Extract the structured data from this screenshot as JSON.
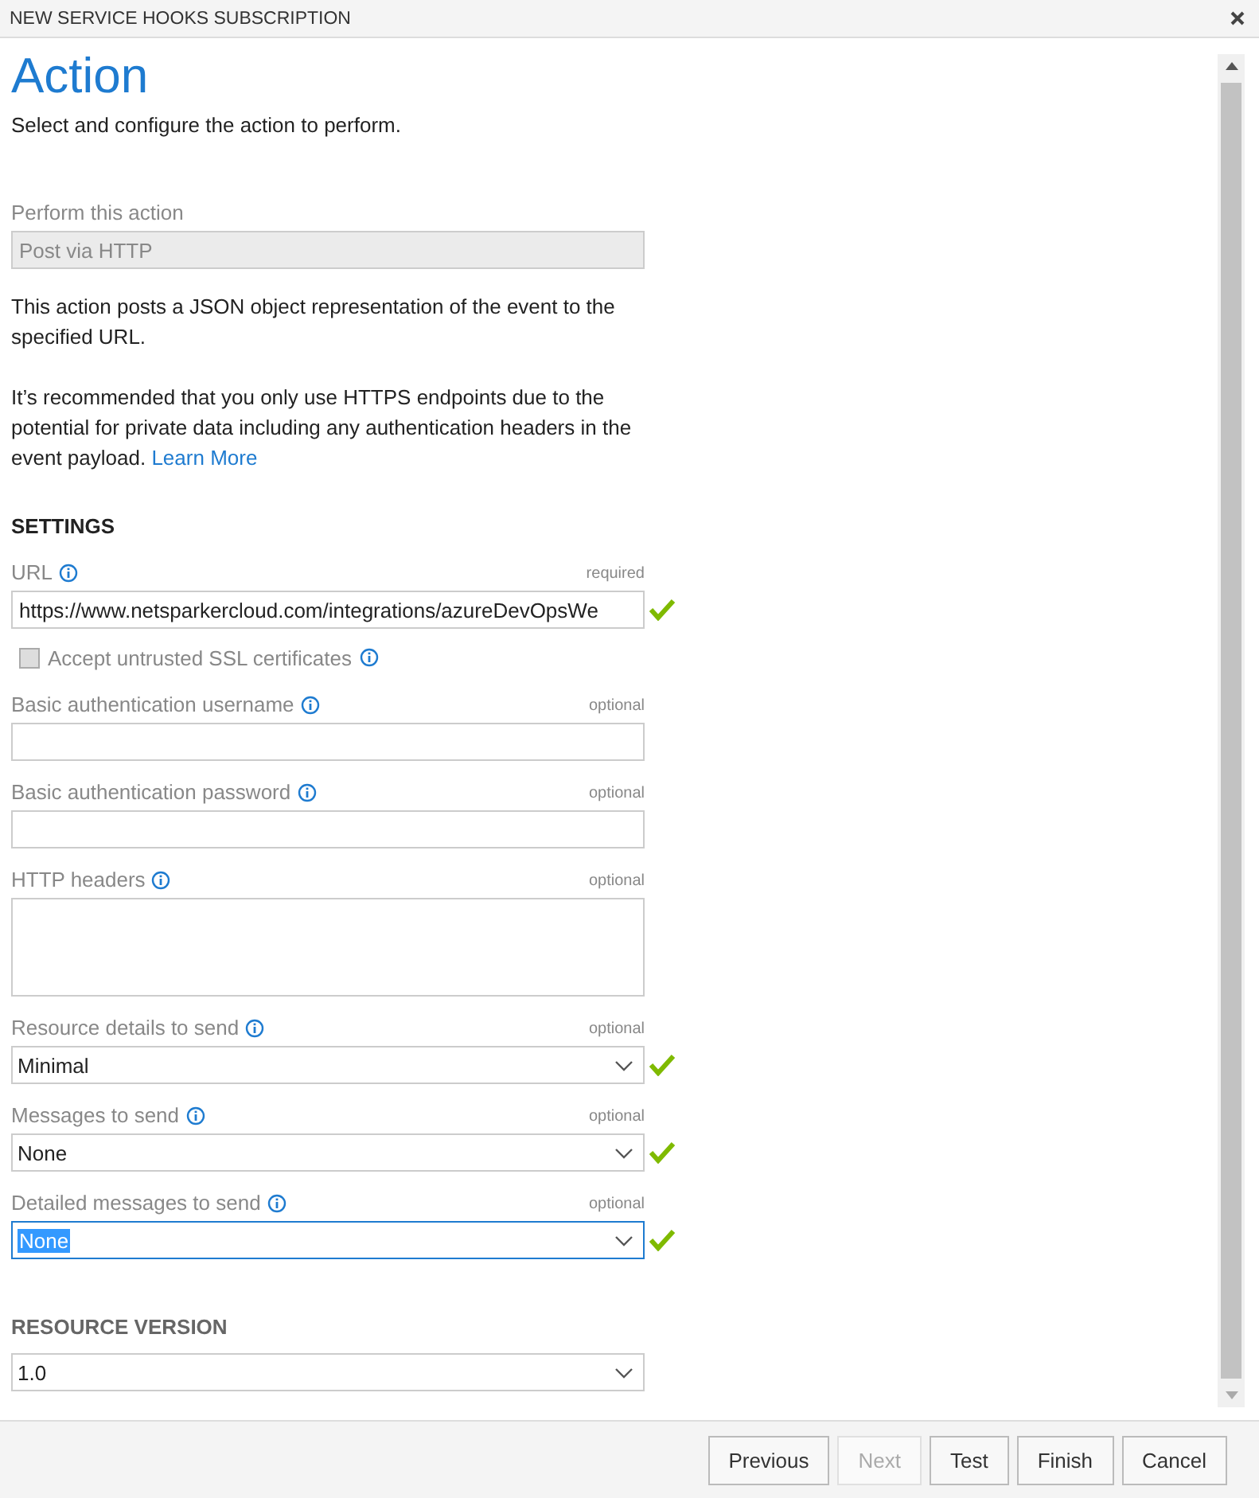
{
  "window": {
    "title": "NEW SERVICE HOOKS SUBSCRIPTION"
  },
  "page": {
    "title": "Action",
    "subtitle": "Select and configure the action to perform."
  },
  "action": {
    "label": "Perform this action",
    "value": "Post via HTTP",
    "disabled": true
  },
  "description": "This action posts a JSON object representation of the event to the specified URL.",
  "note": {
    "text": "It’s recommended that you only use HTTPS endpoints due to the potential for private data including any authentication headers in the event payload.",
    "link": "Learn More"
  },
  "settings": {
    "heading": "SETTINGS",
    "fields": [
      {
        "kind": "text",
        "label": "URL",
        "hint": "required",
        "value": "https://www.netsparkercloud.com/integrations/azureDevOpsWe",
        "valid": true,
        "focused": false
      },
      {
        "kind": "checkbox",
        "label": "Accept untrusted SSL certificates",
        "checked": false
      },
      {
        "kind": "text",
        "label": "Basic authentication username",
        "hint": "optional",
        "valid": false,
        "focused": false
      },
      {
        "kind": "text",
        "label": "Basic authentication password",
        "hint": "optional",
        "valid": false,
        "focused": false
      },
      {
        "kind": "textarea",
        "label": "HTTP headers",
        "hint": "optional",
        "valid": false,
        "focused": false
      },
      {
        "kind": "select",
        "label": "Resource details to send",
        "hint": "optional",
        "value": "Minimal",
        "valid": true,
        "focused": false
      },
      {
        "kind": "select",
        "label": "Messages to send",
        "hint": "optional",
        "value": "None",
        "valid": true,
        "focused": false
      },
      {
        "kind": "select",
        "label": "Detailed messages to send",
        "hint": "optional",
        "value": "None",
        "valid": true,
        "focused": true
      }
    ]
  },
  "resource_version": {
    "heading": "RESOURCE VERSION",
    "value": "1.0"
  },
  "buttons": [
    {
      "label": "Previous",
      "disabled": false
    },
    {
      "label": "Next",
      "disabled": true
    },
    {
      "label": "Test",
      "disabled": false
    },
    {
      "label": "Finish",
      "disabled": false
    },
    {
      "label": "Cancel",
      "disabled": false
    }
  ]
}
